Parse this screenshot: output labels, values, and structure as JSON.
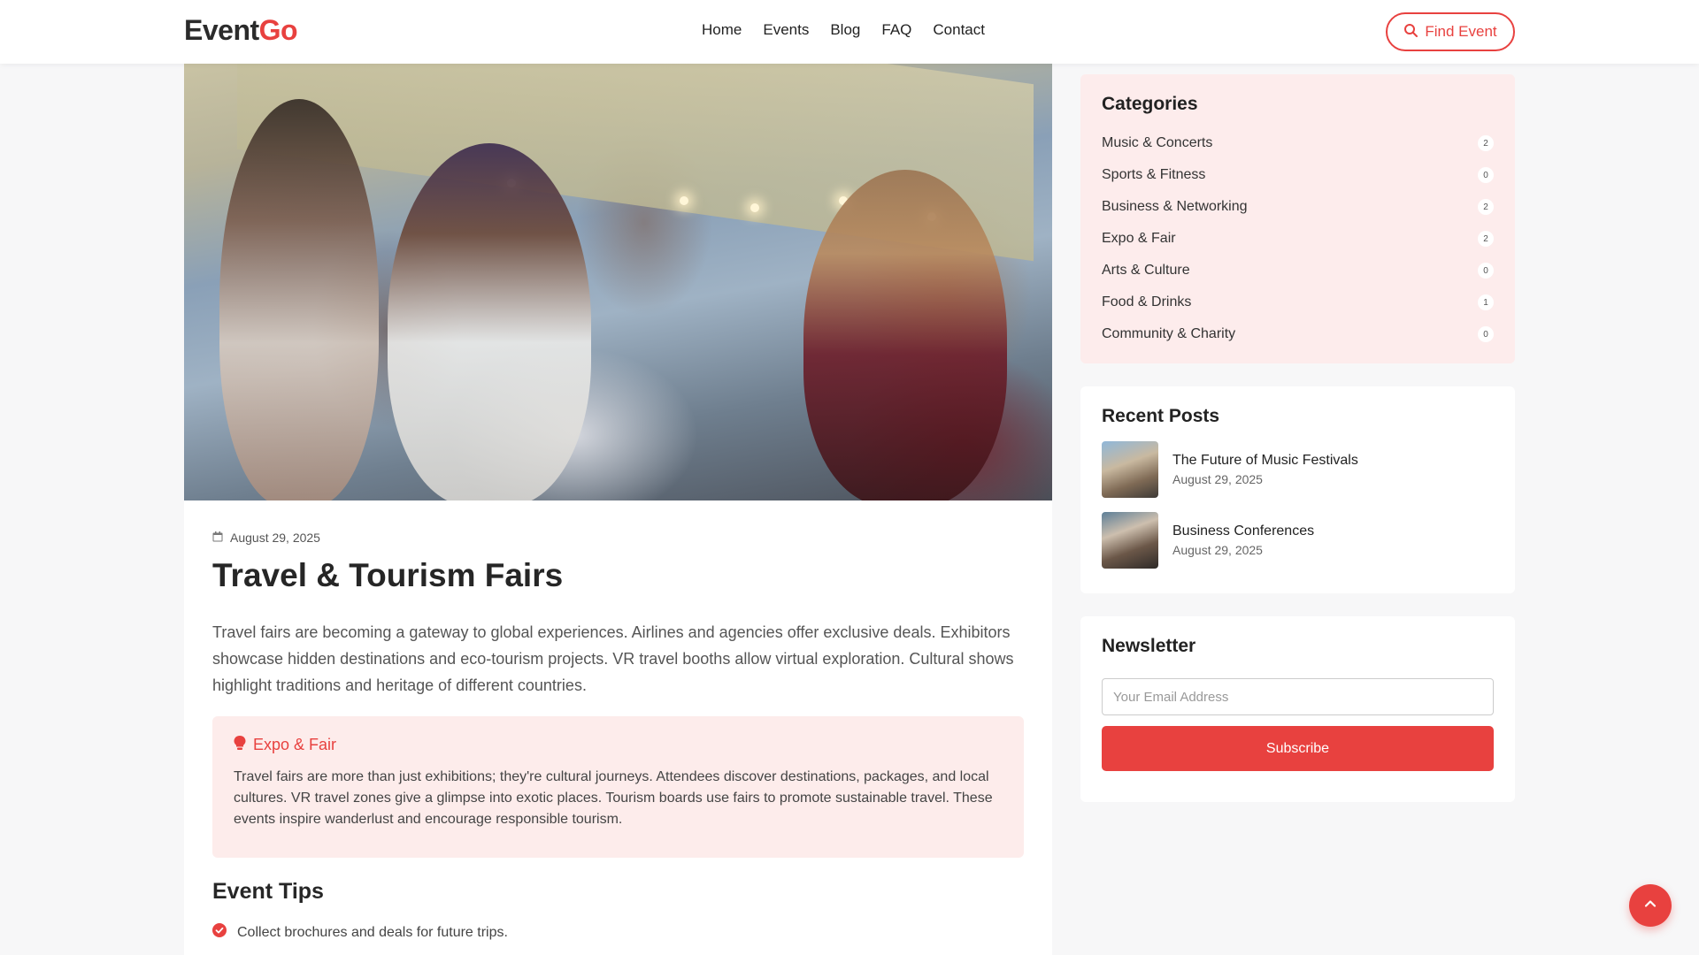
{
  "header": {
    "logo_part1": "Event",
    "logo_part2": "Go",
    "nav": [
      "Home",
      "Events",
      "Blog",
      "FAQ",
      "Contact"
    ],
    "find_button": "Find Event"
  },
  "post": {
    "date": "August 29, 2025",
    "title": "Travel & Tourism Fairs",
    "body": "Travel fairs are becoming a gateway to global experiences. Airlines and agencies offer exclusive deals. Exhibitors showcase hidden destinations and eco-tourism projects. VR travel booths allow virtual exploration. Cultural shows highlight traditions and heritage of different countries.",
    "callout": {
      "title": "Expo & Fair",
      "text": "Travel fairs are more than just exhibitions; they're cultural journeys. Attendees discover destinations, packages, and local cultures. VR travel zones give a glimpse into exotic places. Tourism boards use fairs to promote sustainable travel. These events inspire wanderlust and encourage responsible tourism."
    },
    "tips_title": "Event Tips",
    "tips": [
      "Collect brochures and deals for future trips."
    ]
  },
  "sidebar": {
    "categories_title": "Categories",
    "categories": [
      {
        "label": "Music & Concerts",
        "count": "2"
      },
      {
        "label": "Sports & Fitness",
        "count": "0"
      },
      {
        "label": "Business & Networking",
        "count": "2"
      },
      {
        "label": "Expo & Fair",
        "count": "2"
      },
      {
        "label": "Arts & Culture",
        "count": "0"
      },
      {
        "label": "Food & Drinks",
        "count": "1"
      },
      {
        "label": "Community & Charity",
        "count": "0"
      }
    ],
    "recent_title": "Recent Posts",
    "recent": [
      {
        "title": "The Future of Music Festivals",
        "date": "August 29, 2025"
      },
      {
        "title": "Business Conferences",
        "date": "August 29, 2025"
      }
    ],
    "newsletter_title": "Newsletter",
    "email_placeholder": "Your Email Address",
    "subscribe_label": "Subscribe"
  },
  "colors": {
    "accent": "#e8413f",
    "callout_bg": "#fdeceb"
  }
}
